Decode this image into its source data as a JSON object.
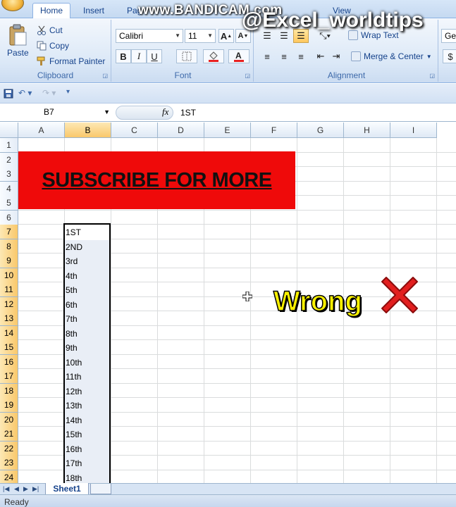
{
  "ribbon": {
    "tabs": [
      "Home",
      "Insert",
      "Pag",
      "View"
    ],
    "clipboard": {
      "paste": "Paste",
      "cut": "Cut",
      "copy": "Copy",
      "format_painter": "Format Painter",
      "label": "Clipboard"
    },
    "font": {
      "name": "Calibri",
      "size": "11",
      "bold": "B",
      "italic": "I",
      "underline": "U",
      "label": "Font"
    },
    "alignment": {
      "wrap_text": "Wrap Text",
      "merge_center": "Merge & Center",
      "label": "Alignment"
    },
    "number": {
      "format_partial": "Ger",
      "currency": "$"
    }
  },
  "watermarks": {
    "recorder": "www.BANDICAM.com",
    "channel": "@Excel_worldtips"
  },
  "formula_bar": {
    "name_box": "B7",
    "fx": "fx",
    "content": "1ST"
  },
  "columns": [
    "A",
    "B",
    "C",
    "D",
    "E",
    "F",
    "G",
    "H",
    "I"
  ],
  "rows": [
    "1",
    "2",
    "3",
    "4",
    "5",
    "6",
    "7",
    "8",
    "9",
    "10",
    "11",
    "12",
    "13",
    "14",
    "15",
    "16",
    "17",
    "18",
    "19",
    "20",
    "21",
    "22",
    "23",
    "24"
  ],
  "banner_text": "SUBSCRIBE FOR MORE",
  "column_b_values": [
    "1ST",
    "2ND",
    "3rd",
    "4th",
    "5th",
    "6th",
    "7th",
    "8th",
    "9th",
    "10th",
    "11th",
    "12th",
    "13th",
    "14th",
    "15th",
    "16th",
    "17th",
    "18th"
  ],
  "overlay": {
    "wrong_label": "Wrong"
  },
  "sheets": [
    "Sheet1"
  ],
  "status": "Ready",
  "colors": {
    "banner": "#ef0a0a",
    "selection_header": "#f9c86b",
    "wrong_text": "#f8f000",
    "x_mark": "#e21f1f"
  }
}
